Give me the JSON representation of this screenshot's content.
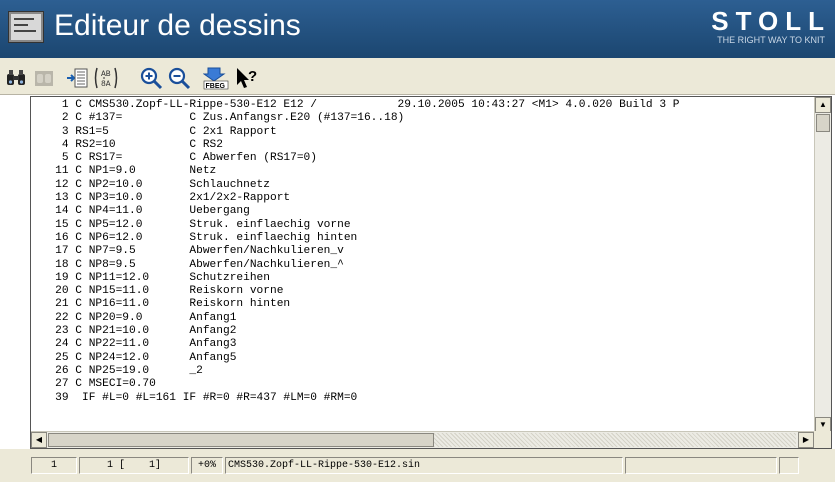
{
  "window": {
    "title": "Editeur de dessins",
    "brand": "STOLL",
    "brand_tagline": "THE RIGHT WAY TO KNIT"
  },
  "toolbar": {
    "buttons": [
      {
        "name": "find-binoculars",
        "icon": "binoculars-icon"
      },
      {
        "name": "find-next",
        "icon": "binoculars-disabled-icon"
      },
      {
        "name": "insert-module",
        "icon": "insert-list-icon"
      },
      {
        "name": "replace",
        "icon": "replace-icon"
      },
      {
        "name": "zoom-in",
        "icon": "zoom-in-icon"
      },
      {
        "name": "zoom-out",
        "icon": "zoom-out-icon"
      },
      {
        "name": "fbeg",
        "icon": "fbeg-icon",
        "label": "FBEG"
      },
      {
        "name": "context-help",
        "icon": "help-pointer-icon",
        "label": "?"
      }
    ]
  },
  "editor": {
    "lines": [
      "    1 C CMS530.Zopf-LL-Rippe-530-E12 E12 /            29.10.2005 10:43:27 <M1> 4.0.020 Build 3 P",
      "    2 C #137=          C Zus.Anfangsr.E20 (#137=16..18)",
      "    3 RS1=5            C 2x1 Rapport",
      "    4 RS2=10           C RS2",
      "    5 C RS17=          C Abwerfen (RS17=0)",
      "   11 C NP1=9.0        Netz",
      "   12 C NP2=10.0       Schlauchnetz",
      "   13 C NP3=10.0       2x1/2x2-Rapport",
      "   14 C NP4=11.0       Uebergang",
      "   15 C NP5=12.0       Struk. einflaechig vorne",
      "   16 C NP6=12.0       Struk. einflaechig hinten",
      "   17 C NP7=9.5        Abwerfen/Nachkulieren_v",
      "   18 C NP8=9.5        Abwerfen/Nachkulieren_^",
      "   19 C NP11=12.0      Schutzreihen",
      "   20 C NP15=11.0      Reiskorn vorne",
      "   21 C NP16=11.0      Reiskorn hinten",
      "   22 C NP20=9.0       Anfang1",
      "   23 C NP21=10.0      Anfang2",
      "   24 C NP22=11.0      Anfang3",
      "   25 C NP24=12.0      Anfang5",
      "   26 C NP25=19.0      _2",
      "   27 C MSECI=0.70",
      "   39  IF #L=0 #L=161 IF #R=0 #R=437 #LM=0 #RM=0"
    ]
  },
  "statusbar": {
    "line": "1",
    "pos": "1 [    1]",
    "percent": "+0%",
    "filename": "CMS530.Zopf-LL-Rippe-530-E12.sin",
    "field5": "",
    "field6": ""
  },
  "colors": {
    "title_bar": "#2d5f92",
    "chrome": "#ece9d8"
  }
}
